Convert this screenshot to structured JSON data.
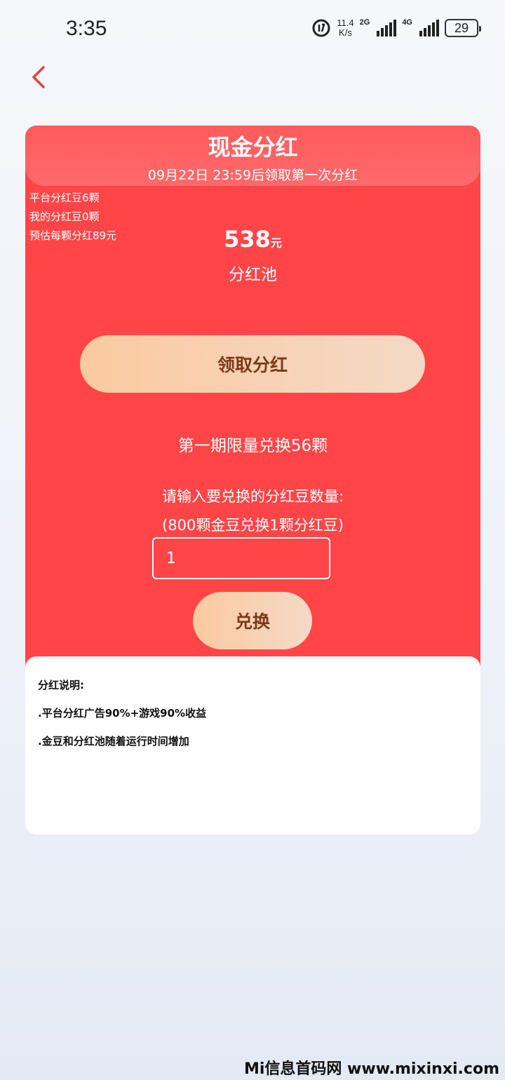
{
  "status_bar": {
    "time": "3:35",
    "speed_value": "11.4",
    "speed_unit": "K/s",
    "net1": "2G",
    "net2": "4G",
    "battery": "29"
  },
  "card": {
    "title": "现金分红",
    "subtitle": "09月22日 23:59后领取第一次分红",
    "platform_beans": "平台分红豆6颗",
    "my_beans": "我的分红豆0颗",
    "estimate": "预估每颗分红89元",
    "pool_amount": "538",
    "pool_unit": "元",
    "pool_label": "分红池",
    "claim_button": "领取分红",
    "limit_text": "第一期限量兑换56颗",
    "prompt_text": "请输入要兑换的分红豆数量:",
    "rate_text": "(800颗金豆兑换1颗分红豆)",
    "input_value": "1",
    "exchange_button": "兑换"
  },
  "explanation": {
    "title": "分红说明:",
    "lines": [
      ".平台分红广告90%+游戏90%收益",
      ".金豆和分红池随着运行时间增加"
    ]
  },
  "watermark": "Mi信息首码网 www.mixinxi.com",
  "colors": {
    "card_red": "#ff4548",
    "button_gold": "#fbcaa0",
    "button_text": "#7a3a1c",
    "back_arrow": "#e0433f"
  },
  "icons": [
    "back-arrow-icon",
    "data-saver-icon",
    "signal-icon",
    "battery-icon"
  ]
}
